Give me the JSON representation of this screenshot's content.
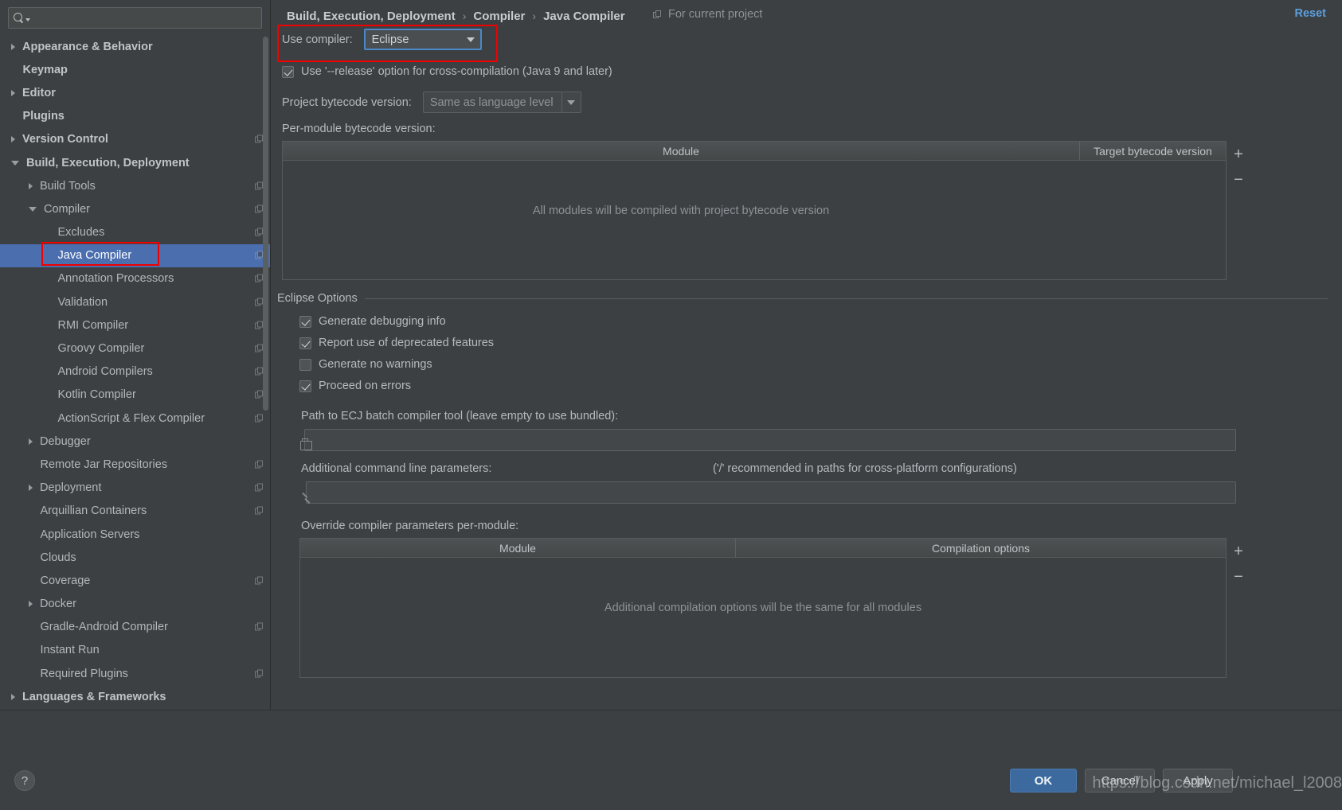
{
  "search": {
    "placeholder": "",
    "value": "",
    "icon": "search-icon"
  },
  "sidebar": {
    "items": [
      {
        "label": "Appearance & Behavior",
        "indent": 0,
        "arrow": "closed",
        "bold": true,
        "copy": false
      },
      {
        "label": "Keymap",
        "indent": 0,
        "arrow": "none",
        "bold": true,
        "copy": false
      },
      {
        "label": "Editor",
        "indent": 0,
        "arrow": "closed",
        "bold": true,
        "copy": false
      },
      {
        "label": "Plugins",
        "indent": 0,
        "arrow": "none",
        "bold": true,
        "copy": false
      },
      {
        "label": "Version Control",
        "indent": 0,
        "arrow": "closed",
        "bold": true,
        "copy": true
      },
      {
        "label": "Build, Execution, Deployment",
        "indent": 0,
        "arrow": "open",
        "bold": true,
        "copy": false
      },
      {
        "label": "Build Tools",
        "indent": 1,
        "arrow": "closed",
        "bold": false,
        "copy": true
      },
      {
        "label": "Compiler",
        "indent": 1,
        "arrow": "open",
        "bold": false,
        "copy": true
      },
      {
        "label": "Excludes",
        "indent": 2,
        "arrow": "none",
        "bold": false,
        "copy": true
      },
      {
        "label": "Java Compiler",
        "indent": 2,
        "arrow": "none",
        "bold": false,
        "copy": true,
        "selected": true
      },
      {
        "label": "Annotation Processors",
        "indent": 2,
        "arrow": "none",
        "bold": false,
        "copy": true
      },
      {
        "label": "Validation",
        "indent": 2,
        "arrow": "none",
        "bold": false,
        "copy": true
      },
      {
        "label": "RMI Compiler",
        "indent": 2,
        "arrow": "none",
        "bold": false,
        "copy": true
      },
      {
        "label": "Groovy Compiler",
        "indent": 2,
        "arrow": "none",
        "bold": false,
        "copy": true
      },
      {
        "label": "Android Compilers",
        "indent": 2,
        "arrow": "none",
        "bold": false,
        "copy": true
      },
      {
        "label": "Kotlin Compiler",
        "indent": 2,
        "arrow": "none",
        "bold": false,
        "copy": true
      },
      {
        "label": "ActionScript & Flex Compiler",
        "indent": 2,
        "arrow": "none",
        "bold": false,
        "copy": true
      },
      {
        "label": "Debugger",
        "indent": 1,
        "arrow": "closed",
        "bold": false,
        "copy": false
      },
      {
        "label": "Remote Jar Repositories",
        "indent": 1,
        "arrow": "none",
        "bold": false,
        "copy": true
      },
      {
        "label": "Deployment",
        "indent": 1,
        "arrow": "closed",
        "bold": false,
        "copy": true
      },
      {
        "label": "Arquillian Containers",
        "indent": 1,
        "arrow": "none",
        "bold": false,
        "copy": true
      },
      {
        "label": "Application Servers",
        "indent": 1,
        "arrow": "none",
        "bold": false,
        "copy": false
      },
      {
        "label": "Clouds",
        "indent": 1,
        "arrow": "none",
        "bold": false,
        "copy": false
      },
      {
        "label": "Coverage",
        "indent": 1,
        "arrow": "none",
        "bold": false,
        "copy": true
      },
      {
        "label": "Docker",
        "indent": 1,
        "arrow": "closed",
        "bold": false,
        "copy": false
      },
      {
        "label": "Gradle-Android Compiler",
        "indent": 1,
        "arrow": "none",
        "bold": false,
        "copy": true
      },
      {
        "label": "Instant Run",
        "indent": 1,
        "arrow": "none",
        "bold": false,
        "copy": false
      },
      {
        "label": "Required Plugins",
        "indent": 1,
        "arrow": "none",
        "bold": false,
        "copy": true
      },
      {
        "label": "Languages & Frameworks",
        "indent": 0,
        "arrow": "closed",
        "bold": true,
        "copy": false
      }
    ],
    "help_label": "?"
  },
  "header": {
    "breadcrumb": [
      "Build, Execution, Deployment",
      "Compiler",
      "Java Compiler"
    ],
    "separator": "›",
    "scope_text": "For current project",
    "scope_icon": "copy-scope-icon",
    "reset_label": "Reset"
  },
  "main": {
    "use_compiler_label": "Use compiler:",
    "use_compiler_value": "Eclipse",
    "release_option": {
      "label": "Use '--release' option for cross-compilation (Java 9 and later)",
      "checked": true
    },
    "project_bytecode_label": "Project bytecode version:",
    "project_bytecode_value": "Same as language level",
    "per_module_label": "Per-module bytecode version:",
    "per_module_table": {
      "columns": [
        "Module",
        "Target bytecode version"
      ],
      "rows": [],
      "empty_text": "All modules will be compiled with project bytecode version",
      "add_label": "+",
      "remove_label": "−"
    },
    "eclipse_options": {
      "group_label": "Eclipse Options",
      "checkboxes": [
        {
          "label": "Generate debugging info",
          "checked": true
        },
        {
          "label": "Report use of deprecated features",
          "checked": true
        },
        {
          "label": "Generate no warnings",
          "checked": false
        },
        {
          "label": "Proceed on errors",
          "checked": true
        }
      ],
      "ecj_path_label": "Path to ECJ batch compiler tool (leave empty to use bundled):",
      "ecj_path_value": "",
      "ecj_path_icon": "folder-browse-icon",
      "additional_params_label": "Additional command line parameters:",
      "additional_params_hint": "('/' recommended in paths for cross-platform configurations)",
      "additional_params_value": "",
      "additional_params_icon": "expand-editor-icon",
      "override_label": "Override compiler parameters per-module:",
      "override_table": {
        "columns": [
          "Module",
          "Compilation options"
        ],
        "rows": [],
        "empty_text": "Additional compilation options will be the same for all modules",
        "add_label": "+",
        "remove_label": "−"
      }
    }
  },
  "footer": {
    "ok_label": "OK",
    "cancel_label": "Cancel",
    "apply_label": "Apply",
    "watermark": "https://blog.csdn.net/michael_l2008"
  },
  "colors": {
    "accent": "#4b6eaf",
    "link": "#5c9ede",
    "annotation": "#f00000",
    "background": "#3c4043"
  }
}
